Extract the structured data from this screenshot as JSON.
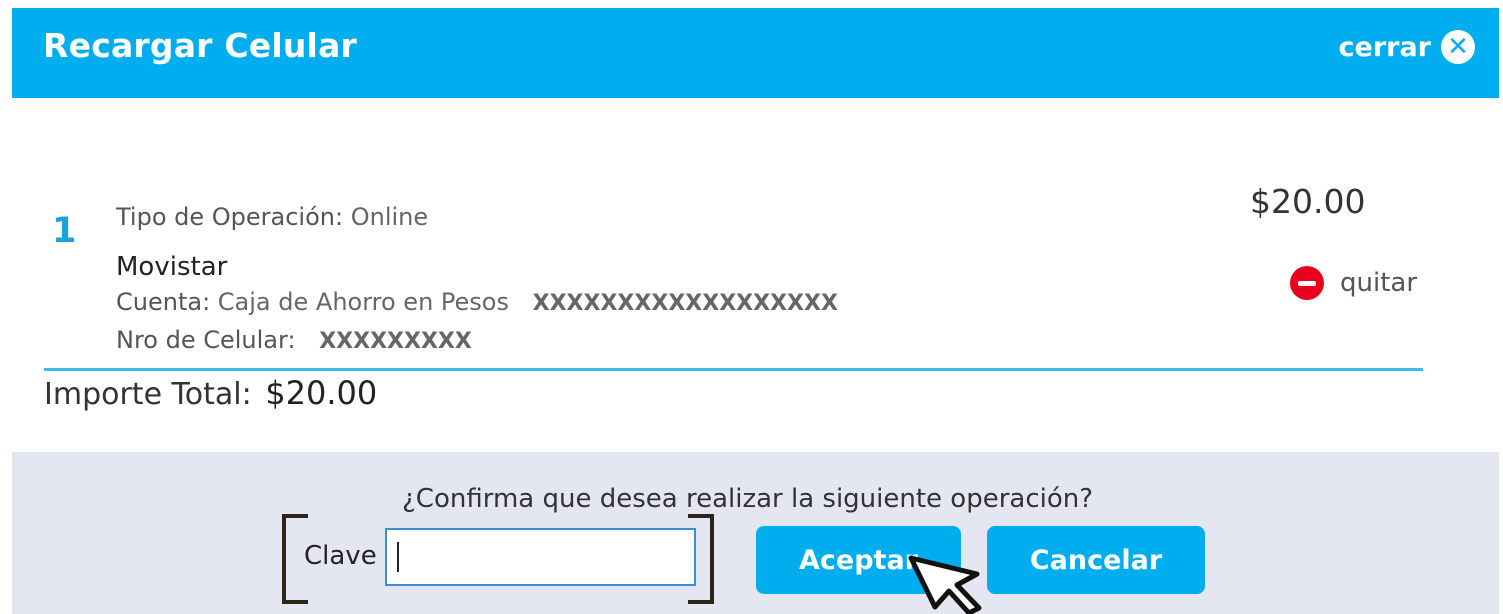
{
  "header": {
    "title": "Recargar Celular",
    "close_label": "cerrar",
    "close_icon": "close-circle-icon"
  },
  "item": {
    "number": "1",
    "operation_type_label": "Tipo de Operación:",
    "operation_type_value": "Online",
    "carrier": "Movistar",
    "account_label": "Cuenta:",
    "account_value": "Caja de Ahorro en Pesos",
    "account_number": "XXXXXXXXXXXXXXXXXX",
    "phone_label": "Nro de Celular:",
    "phone_number": "XXXXXXXXX",
    "amount": "$20.00",
    "remove_label": "quitar",
    "remove_icon": "minus-circle-icon"
  },
  "total": {
    "label": "Importe Total:",
    "value": "$20.00"
  },
  "confirm": {
    "question": "¿Confirma que desea realizar la siguiente operación?",
    "password_label": "Clave",
    "password_value": "",
    "accept_label": "Aceptar",
    "cancel_label": "Cancelar"
  },
  "colors": {
    "accent": "#00aeef",
    "panel": "#e4e7f2",
    "remove": "#e8001c"
  }
}
